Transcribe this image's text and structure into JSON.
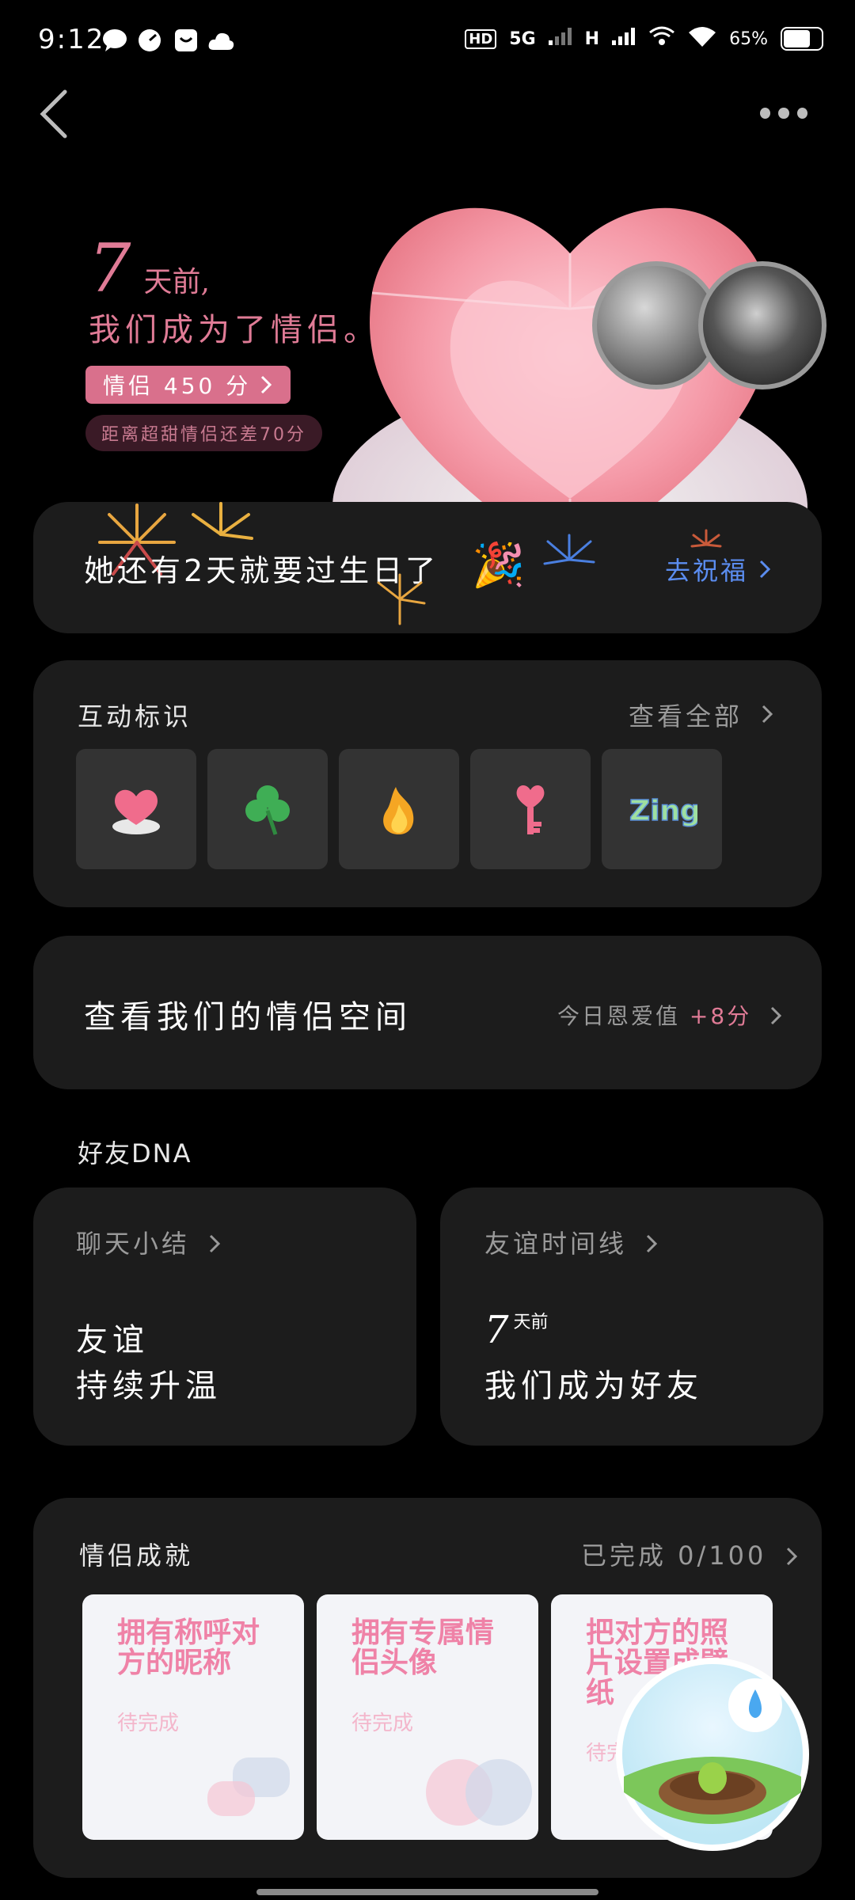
{
  "status_bar": {
    "time": "9:12",
    "network": "5G",
    "network2": "H",
    "battery": "65%"
  },
  "hero": {
    "days_num": "7",
    "days_suffix": "天前,",
    "line2": "我们成为了情侣。",
    "score_pill": "情侣 450 分",
    "gap_text": "距离超甜情侣还差70分"
  },
  "birthday": {
    "text": "她还有2天就要过生日了",
    "link": "去祝福"
  },
  "badges": {
    "title": "互动标识",
    "view_all": "查看全部",
    "items": [
      "heart-badge",
      "clover-badge",
      "fire-badge",
      "key-badge",
      "zing-badge"
    ]
  },
  "space": {
    "title": "查看我们的情侣空间",
    "sub_label": "今日恩爱值",
    "sub_value": "+8分"
  },
  "dna": {
    "title": "好友DNA",
    "chat_summary": {
      "head": "聊天小结",
      "line1": "友谊",
      "line2": "持续升温"
    },
    "timeline": {
      "head": "友谊时间线",
      "days_num": "7",
      "days_suffix": "天前",
      "line2": "我们成为好友"
    }
  },
  "achievements": {
    "title": "情侣成就",
    "progress": "已完成 0/100",
    "items": [
      {
        "title": "拥有称呼对方的昵称",
        "status": "待完成"
      },
      {
        "title": "拥有专属情侣头像",
        "status": "待完成"
      },
      {
        "title": "把对方的照片设置成壁纸",
        "status": "待完成"
      }
    ]
  },
  "colors": {
    "accent_pink": "#e07b96",
    "link_blue": "#5b8df0",
    "card_bg": "#1c1c1c"
  }
}
